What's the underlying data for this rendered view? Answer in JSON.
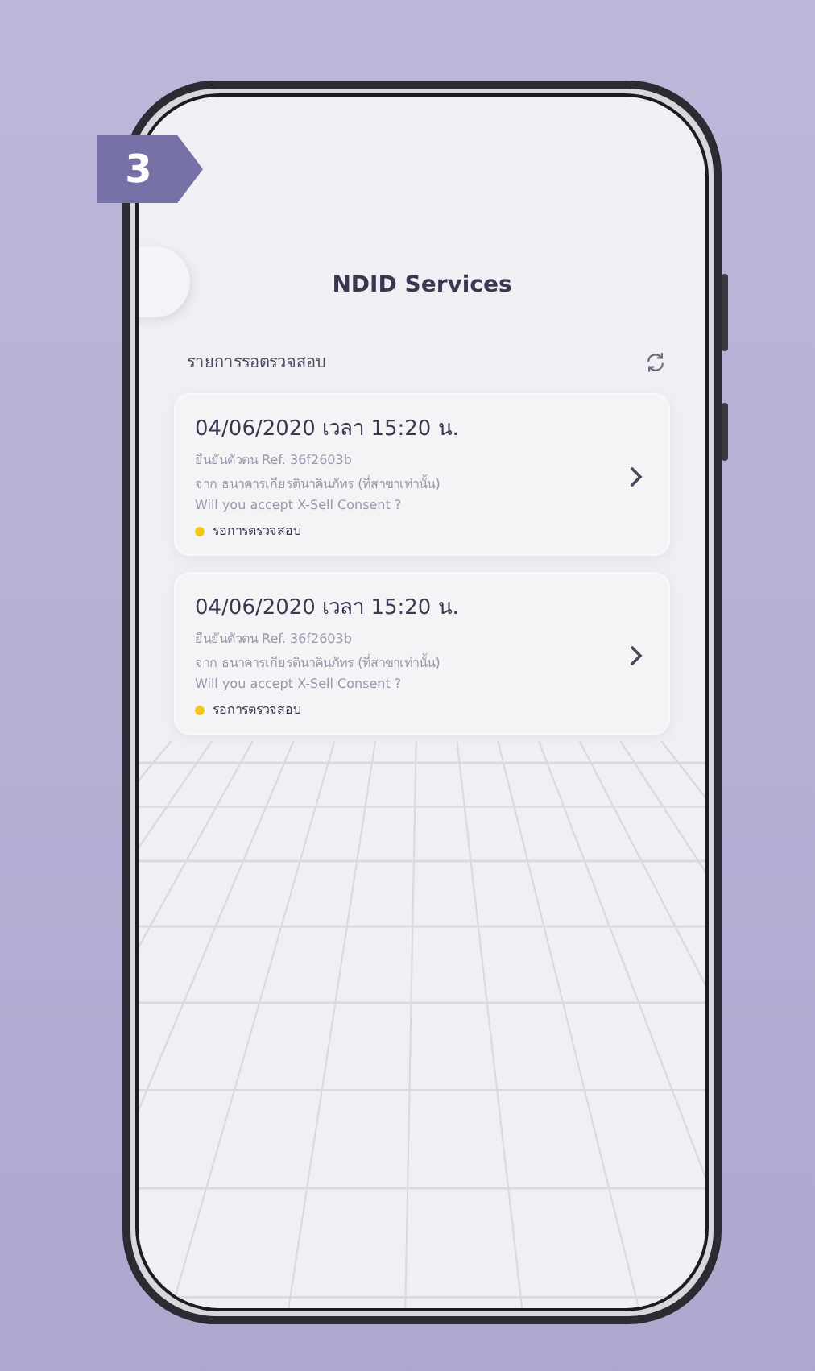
{
  "step_badge": "3",
  "header": {
    "title": "NDID Services"
  },
  "section": {
    "label": "รายการรอตรวจสอบ"
  },
  "requests": [
    {
      "datetime": "04/06/2020 เวลา 15:20 น.",
      "reference": "ยืนยันตัวตน Ref. 36f2603b",
      "source": "จาก ธนาคารเกียรตินาคินภัทร (ที่สาขาเท่านั้น)",
      "question": "Will you accept X-Sell Consent ?",
      "status": "รอการตรวจสอบ",
      "color": "#f5c518"
    },
    {
      "datetime": "04/06/2020 เวลา 15:20 น.",
      "reference": "ยืนยันตัวตน Ref. 36f2603b",
      "source": "จาก ธนาคารเกียรตินาคินภัทร (ที่สาขาเท่านั้น)",
      "question": "Will you accept X-Sell Consent ?",
      "status": "รอการตรวจสอบ",
      "color": "#f5c518"
    }
  ]
}
